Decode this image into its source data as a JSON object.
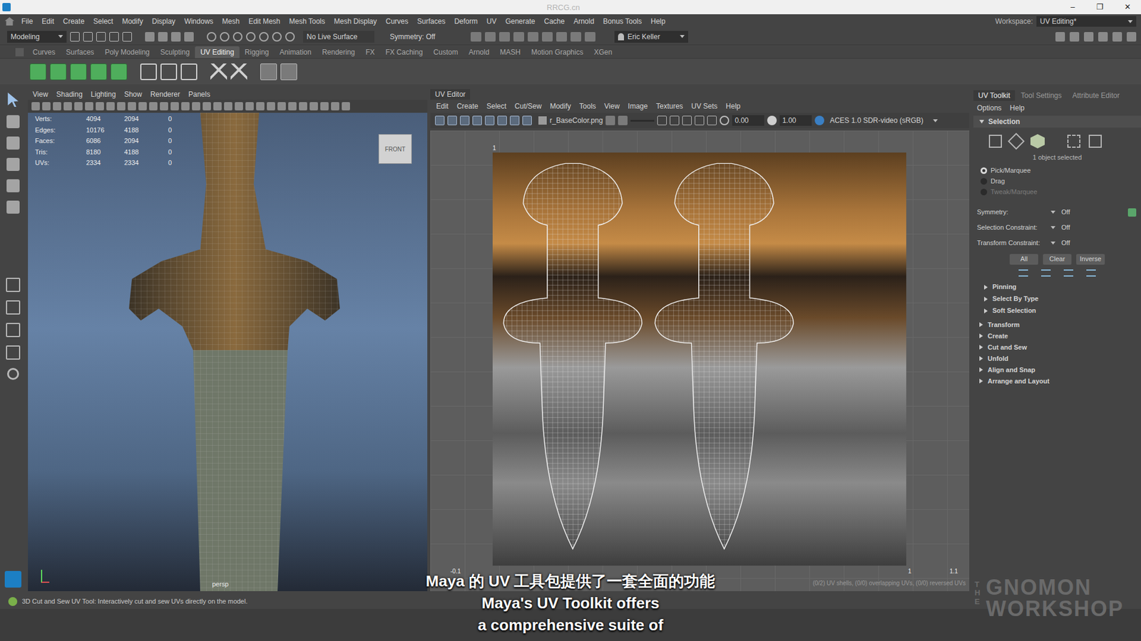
{
  "window": {
    "watermark": "RRCG.cn",
    "controls": [
      "–",
      "❐",
      "✕"
    ]
  },
  "menu_bar": {
    "items": [
      "File",
      "Edit",
      "Create",
      "Select",
      "Modify",
      "Display",
      "Windows",
      "Mesh",
      "Edit Mesh",
      "Mesh Tools",
      "Mesh Display",
      "Curves",
      "Surfaces",
      "Deform",
      "UV",
      "Generate",
      "Cache",
      "Arnold",
      "Bonus Tools",
      "Help"
    ],
    "workspace_label": "Workspace:",
    "workspace": "UV Editing*"
  },
  "status_line": {
    "mode": "Modeling",
    "live_surface": "No Live Surface",
    "symmetry": "Symmetry: Off",
    "user": "Eric Keller"
  },
  "shelf": {
    "tabs": [
      {
        "label": "Curves",
        "selected": false
      },
      {
        "label": "Surfaces",
        "selected": false
      },
      {
        "label": "Poly Modeling",
        "selected": false
      },
      {
        "label": "Sculpting",
        "selected": false
      },
      {
        "label": "UV Editing",
        "selected": true
      },
      {
        "label": "Rigging",
        "selected": false
      },
      {
        "label": "Animation",
        "selected": false
      },
      {
        "label": "Rendering",
        "selected": false
      },
      {
        "label": "FX",
        "selected": false
      },
      {
        "label": "FX Caching",
        "selected": false
      },
      {
        "label": "Custom",
        "selected": false
      },
      {
        "label": "Arnold",
        "selected": false
      },
      {
        "label": "MASH",
        "selected": false
      },
      {
        "label": "Motion Graphics",
        "selected": false
      },
      {
        "label": "XGen",
        "selected": false
      }
    ]
  },
  "viewport": {
    "menu": [
      "View",
      "Shading",
      "Lighting",
      "Show",
      "Renderer",
      "Panels"
    ],
    "hud": [
      {
        "label": "Verts:",
        "values": [
          "4094",
          "2094",
          "0"
        ]
      },
      {
        "label": "Edges:",
        "values": [
          "10176",
          "4188",
          "0"
        ]
      },
      {
        "label": "Faces:",
        "values": [
          "6086",
          "2094",
          "0"
        ]
      },
      {
        "label": "Tris:",
        "values": [
          "8180",
          "4188",
          "0"
        ]
      },
      {
        "label": "UVs:",
        "values": [
          "2334",
          "2334",
          "0"
        ]
      }
    ],
    "view_cube": "FRONT",
    "camera": "persp"
  },
  "uv_editor": {
    "title": "UV Editor",
    "menu": [
      "Edit",
      "Create",
      "Select",
      "Cut/Sew",
      "Modify",
      "Tools",
      "View",
      "Image",
      "Textures",
      "UV Sets",
      "Help"
    ],
    "texture": "r_BaseColor.png",
    "exposure": "0.00",
    "gamma": "1.00",
    "color_space": "ACES 1.0 SDR-video (sRGB)",
    "axis_labels": {
      "top": "1",
      "bottom_left": "-0.1",
      "bottom_right": "1",
      "far_right": "1.1"
    },
    "info": "(0/2) UV shells, (0/0) overlapping UVs, (0/0) reversed UVs"
  },
  "uv_toolkit": {
    "tabs": [
      {
        "label": "UV Toolkit",
        "selected": true
      },
      {
        "label": "Tool Settings",
        "selected": false
      },
      {
        "label": "Attribute Editor",
        "selected": false
      }
    ],
    "menu": [
      "Options",
      "Help"
    ],
    "selection": {
      "title": "Selection",
      "expanded": true,
      "status": "1 object selected",
      "modes": [
        {
          "label": "Pick/Marquee",
          "selected": true,
          "disabled": false
        },
        {
          "label": "Drag",
          "selected": false,
          "disabled": false
        },
        {
          "label": "Tweak/Marquee",
          "selected": false,
          "disabled": true
        }
      ],
      "fields": [
        {
          "label": "Symmetry:",
          "value": "Off"
        },
        {
          "label": "Selection Constraint:",
          "value": "Off"
        },
        {
          "label": "Transform Constraint:",
          "value": "Off"
        }
      ],
      "buttons": [
        "All",
        "Clear",
        "Inverse"
      ],
      "subsections": [
        {
          "label": "Pinning",
          "expanded": false
        },
        {
          "label": "Select By Type",
          "expanded": false
        },
        {
          "label": "Soft Selection",
          "expanded": false
        }
      ]
    },
    "sections": [
      {
        "label": "Transform",
        "expanded": false
      },
      {
        "label": "Create",
        "expanded": false
      },
      {
        "label": "Cut and Sew",
        "expanded": false
      },
      {
        "label": "Unfold",
        "expanded": false
      },
      {
        "label": "Align and Snap",
        "expanded": false
      },
      {
        "label": "Arrange and Layout",
        "expanded": false
      }
    ]
  },
  "help_line": "3D Cut and Sew UV Tool: Interactively cut and sew UVs directly on the model.",
  "subtitles": [
    "Maya 的 UV 工具包提供了一套全面的功能",
    "Maya's UV Toolkit offers",
    "a comprehensive suite of"
  ],
  "brand": [
    "THE",
    "GNOMON",
    "WORKSHOP"
  ]
}
